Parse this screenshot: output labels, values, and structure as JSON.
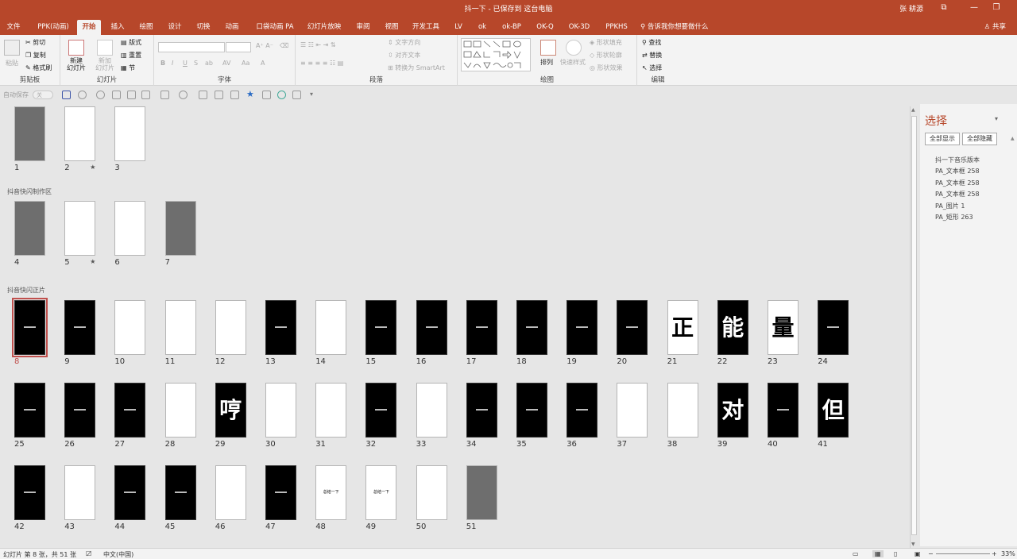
{
  "title_bar": {
    "title": "抖一下 - 已保存到 这台电脑",
    "user": "张 耕源",
    "window_buttons": [
      "restore-icon",
      "minimize-icon",
      "maximize-icon"
    ],
    "restore_glyph": "⧉",
    "minimize_glyph": "—",
    "maximize_glyph": "❐"
  },
  "tabs": [
    "文件",
    "PPK(动画)",
    "开始",
    "插入",
    "绘图",
    "设计",
    "切换",
    "动画",
    "口袋动画 PA",
    "幻灯片放映",
    "审阅",
    "视图",
    "开发工具",
    "LV",
    "ok",
    "ok-BP",
    "OK-Q",
    "OK-3D",
    "PPKHS"
  ],
  "active_tab": "开始",
  "tell_me": "告诉我你想要做什么",
  "share": "共享",
  "ribbon": {
    "clipboard": {
      "label": "剪贴板",
      "paste": "粘贴",
      "cut": "剪切",
      "copy": "复制",
      "format_painter": "格式刷"
    },
    "slides": {
      "label": "幻灯片",
      "new_slide": "新建\n幻灯片",
      "reuse_slide": "新加\n幻灯片",
      "layout": "版式",
      "reset": "重置",
      "section": "节"
    },
    "font": {
      "label": "字体",
      "buttons": [
        "B",
        "I",
        "U",
        "S",
        "ab",
        "AV",
        "Aa",
        "A"
      ]
    },
    "paragraph": {
      "label": "段落",
      "text_direction": "文字方向",
      "align_text": "对齐文本",
      "smartart": "转换为 SmartArt"
    },
    "drawing": {
      "label": "绘图",
      "arrange": "排列",
      "quick_styles": "快速样式",
      "shape_fill": "形状填充",
      "shape_outline": "形状轮廓",
      "shape_effects": "形状效果"
    },
    "editing": {
      "label": "编辑",
      "find": "查找",
      "replace": "替换",
      "select": "选择"
    }
  },
  "qat": {
    "autosave": "自动保存",
    "autosave_state": "关"
  },
  "sections": [
    {
      "name": "",
      "slides": [
        {
          "n": "1",
          "style": "gray",
          "text": "",
          "star": false
        },
        {
          "n": "2",
          "style": "white",
          "text": "",
          "star": true
        },
        {
          "n": "3",
          "style": "white",
          "text": "",
          "star": false
        }
      ]
    },
    {
      "name": "抖音快闪制作区",
      "slides": [
        {
          "n": "4",
          "style": "gray",
          "text": "",
          "star": false
        },
        {
          "n": "5",
          "style": "white",
          "text": "",
          "star": true
        },
        {
          "n": "6",
          "style": "white",
          "text": "",
          "star": false
        },
        {
          "n": "7",
          "style": "gray",
          "text": "",
          "star": false
        }
      ]
    },
    {
      "name": "抖音快闪正片",
      "slides": [
        {
          "n": "8",
          "style": "black",
          "text": "",
          "star": false,
          "selected": true
        },
        {
          "n": "9",
          "style": "black",
          "text": "",
          "star": false
        },
        {
          "n": "10",
          "style": "white",
          "text": "",
          "star": false
        },
        {
          "n": "11",
          "style": "white",
          "text": "",
          "star": false
        },
        {
          "n": "12",
          "style": "white",
          "text": "",
          "star": false
        },
        {
          "n": "13",
          "style": "black",
          "text": "",
          "star": false
        },
        {
          "n": "14",
          "style": "white",
          "text": "",
          "star": false
        },
        {
          "n": "15",
          "style": "black",
          "text": "",
          "star": false
        },
        {
          "n": "16",
          "style": "black",
          "text": "",
          "star": false
        },
        {
          "n": "17",
          "style": "black",
          "text": "",
          "star": false
        },
        {
          "n": "18",
          "style": "black",
          "text": "",
          "star": false
        },
        {
          "n": "19",
          "style": "black",
          "text": "",
          "star": false
        },
        {
          "n": "20",
          "style": "black",
          "text": "",
          "star": false
        },
        {
          "n": "21",
          "style": "white",
          "text": "正",
          "star": false
        },
        {
          "n": "22",
          "style": "black",
          "text": "能",
          "star": false
        },
        {
          "n": "23",
          "style": "white",
          "text": "量",
          "star": false
        },
        {
          "n": "24",
          "style": "black",
          "text": "",
          "star": false
        },
        {
          "n": "25",
          "style": "black",
          "text": "",
          "star": false
        },
        {
          "n": "26",
          "style": "black",
          "text": "",
          "star": false
        },
        {
          "n": "27",
          "style": "black",
          "text": "",
          "star": false
        },
        {
          "n": "28",
          "style": "white",
          "text": "",
          "star": false
        },
        {
          "n": "29",
          "style": "black",
          "text": "哼",
          "star": false
        },
        {
          "n": "30",
          "style": "white",
          "text": "",
          "star": false
        },
        {
          "n": "31",
          "style": "white",
          "text": "",
          "star": false
        },
        {
          "n": "32",
          "style": "black",
          "text": "",
          "star": false
        },
        {
          "n": "33",
          "style": "white",
          "text": "",
          "star": false
        },
        {
          "n": "34",
          "style": "black",
          "text": "",
          "star": false
        },
        {
          "n": "35",
          "style": "black",
          "text": "",
          "star": false
        },
        {
          "n": "36",
          "style": "black",
          "text": "",
          "star": false
        },
        {
          "n": "37",
          "style": "white",
          "text": "",
          "star": false
        },
        {
          "n": "38",
          "style": "white",
          "text": "",
          "star": false
        },
        {
          "n": "39",
          "style": "black",
          "text": "对",
          "star": false
        },
        {
          "n": "40",
          "style": "black",
          "text": "",
          "star": false
        },
        {
          "n": "41",
          "style": "black",
          "text": "但",
          "star": false
        },
        {
          "n": "42",
          "style": "black",
          "text": "",
          "star": false
        },
        {
          "n": "43",
          "style": "white",
          "text": "",
          "star": false
        },
        {
          "n": "44",
          "style": "black",
          "text": "",
          "star": false
        },
        {
          "n": "45",
          "style": "black",
          "text": "",
          "star": false
        },
        {
          "n": "46",
          "style": "white",
          "text": "",
          "star": false
        },
        {
          "n": "47",
          "style": "black",
          "text": "",
          "star": false
        },
        {
          "n": "48",
          "style": "white",
          "text": "总结一下",
          "star": false
        },
        {
          "n": "49",
          "style": "white",
          "text": "总结一下",
          "star": false
        },
        {
          "n": "50",
          "style": "white",
          "text": "",
          "star": false
        },
        {
          "n": "51",
          "style": "gray",
          "text": "",
          "star": false
        }
      ]
    }
  ],
  "selection_pane": {
    "title": "选择",
    "show_all": "全部显示",
    "hide_all": "全部隐藏",
    "items": [
      "抖一下音乐版本",
      "PA_文本框 258",
      "PA_文本框 258",
      "PA_文本框 258",
      "PA_图片 1",
      "PA_矩形 263"
    ]
  },
  "status": {
    "slide_info": "幻灯片 第 8 张，共 51 张",
    "language": "中文(中国)",
    "zoom": "33%"
  },
  "colors": {
    "accent": "#b7472a",
    "selection": "#c0504d"
  }
}
